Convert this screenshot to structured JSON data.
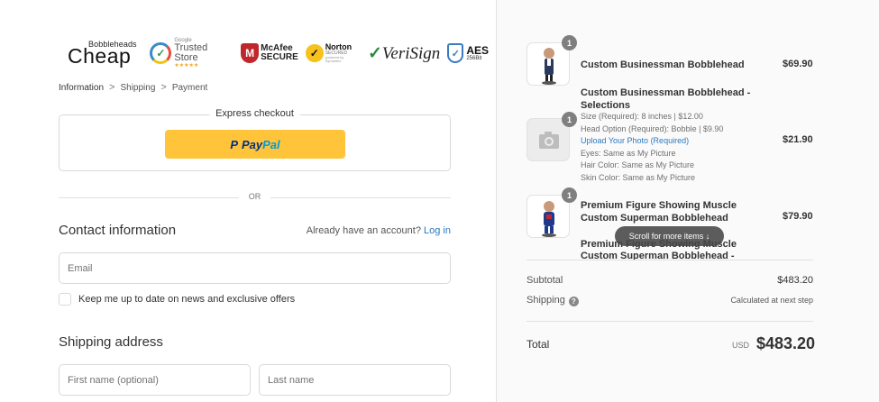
{
  "header": {
    "brand_small": "Bobbleheads",
    "brand_big": "Cheap",
    "trust_badges": {
      "trusted_google": "Google",
      "trusted_store": "Trusted Store",
      "trusted_stars": "★★★★★",
      "mcafee_line1": "McAfee",
      "mcafee_line2": "SECURE",
      "norton": "Norton",
      "norton_secured": "SECURED",
      "norton_powered": "powered by Symantec",
      "verisign": "VeriSign",
      "aes": "AES",
      "aes_bits": "256Bit"
    }
  },
  "breadcrumb": {
    "items": [
      "Information",
      "Shipping",
      "Payment"
    ],
    "separator": ">"
  },
  "express": {
    "title": "Express checkout",
    "paypal_part1": "Pay",
    "paypal_part2": "Pal",
    "paypal_mark": "P"
  },
  "divider_or": "OR",
  "contact": {
    "title": "Contact information",
    "account_prompt": "Already have an account?",
    "login_link": "Log in",
    "email_placeholder": "Email",
    "newsletter_label": "Keep me up to date on news and exclusive offers"
  },
  "shipping": {
    "title": "Shipping address",
    "first_name_placeholder": "First name (optional)",
    "last_name_placeholder": "Last name"
  },
  "cart": {
    "items": [
      {
        "qty": "1",
        "name": "Custom Businessman Bobblehead",
        "price": "$69.90"
      },
      {
        "qty": "1",
        "name_line1": "Custom Businessman Bobblehead -",
        "name_line2": "Selections",
        "price": "$21.90",
        "options": [
          "Size (Required): 8 inches | $12.00",
          "Head Option (Required): Bobble | $9.90",
          "Upload Your Photo (Required)",
          "Eyes: Same as My Picture",
          "Hair Color: Same as My Picture",
          "Skin Color: Same as My Picture"
        ]
      },
      {
        "qty": "1",
        "name_line1": "Premium Figure Showing Muscle",
        "name_line2": "Custom Superman Bobblehead",
        "price": "$79.90"
      },
      {
        "name_line1": "Premium Figure Showing Muscle",
        "name_line2": "Custom Superman Bobblehead -"
      }
    ],
    "scroll_hint": "Scroll for more items ↓"
  },
  "summary": {
    "subtotal_label": "Subtotal",
    "subtotal_value": "$483.20",
    "shipping_label": "Shipping",
    "shipping_value": "Calculated at next step",
    "help_icon": "?",
    "total_label": "Total",
    "currency": "USD",
    "total_value": "$483.20"
  }
}
